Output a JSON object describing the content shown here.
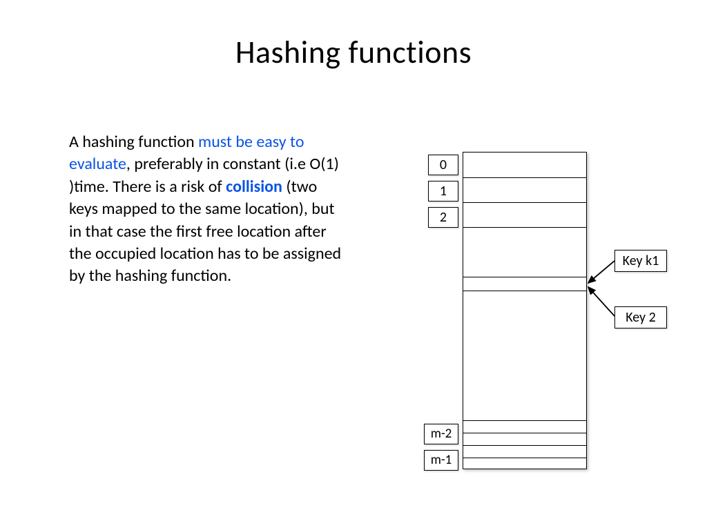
{
  "title": "Hashing functions",
  "paragraph": {
    "p1a": "A hashing function ",
    "p1b_hl": "must be easy to evaluate",
    "p1c": ", preferably in constant (i.e O(1) )time. There is a risk of ",
    "p1d_hl": "collision",
    "p1e": " (two keys mapped to the same location), but in that case the first free location after the occupied location has to be assigned by the hashing function."
  },
  "indices": {
    "i0": "0",
    "i1": "1",
    "i2": "2",
    "im2": "m-2",
    "im1": "m-1"
  },
  "keys": {
    "k1": "Key k1",
    "k2": "Key 2"
  }
}
